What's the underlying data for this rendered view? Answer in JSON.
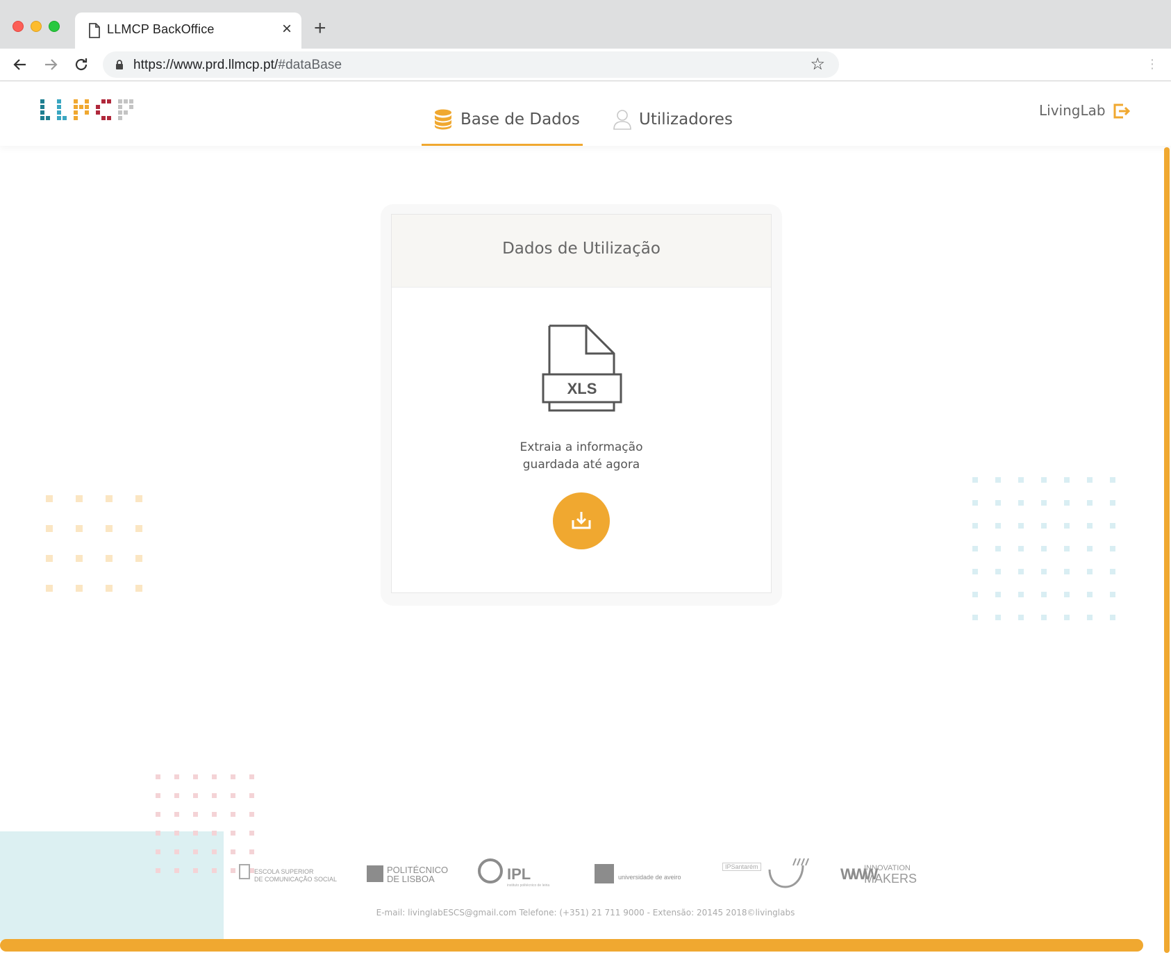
{
  "browser": {
    "tab_title": "LLMCP BackOffice",
    "new_tab": "+",
    "tab_close": "×",
    "url_host": "https://www.prd.llmcp.pt/",
    "url_path": "#dataBase"
  },
  "header": {
    "nav": [
      {
        "label": "Base de Dados",
        "icon": "database-icon",
        "active": true
      },
      {
        "label": "Utilizadores",
        "icon": "user-icon",
        "active": false
      }
    ],
    "user_name": "LivingLab",
    "logout_icon": "logout-icon",
    "accent_color": "#f0a830"
  },
  "card": {
    "title": "Dados de Utilização",
    "file_type": "XLS",
    "description_line1": "Extraia a informação",
    "description_line2": "guardada até agora",
    "button_icon": "download-icon"
  },
  "footer": {
    "partners": {
      "escs_line1": "ESCOLA SUPERIOR",
      "escs_line2": "DE COMUNICAÇÃO SOCIAL",
      "ipl_lisboa_line1": "POLITÉCNICO",
      "ipl_lisboa_line2": "DE LISBOA",
      "ipl": "IPL",
      "ipl_sub": "instituto politécnico de leiria",
      "ua": "universidade de aveiro",
      "santarem": "IPSantarém",
      "innovation_line1": "INNOVATION",
      "innovation_line2": "MAKERS"
    },
    "contact": "E-mail: livinglabESCS@gmail.com Telefone: (+351) 21 711 9000 - Extensão: 20145 2018©livinglabs"
  }
}
